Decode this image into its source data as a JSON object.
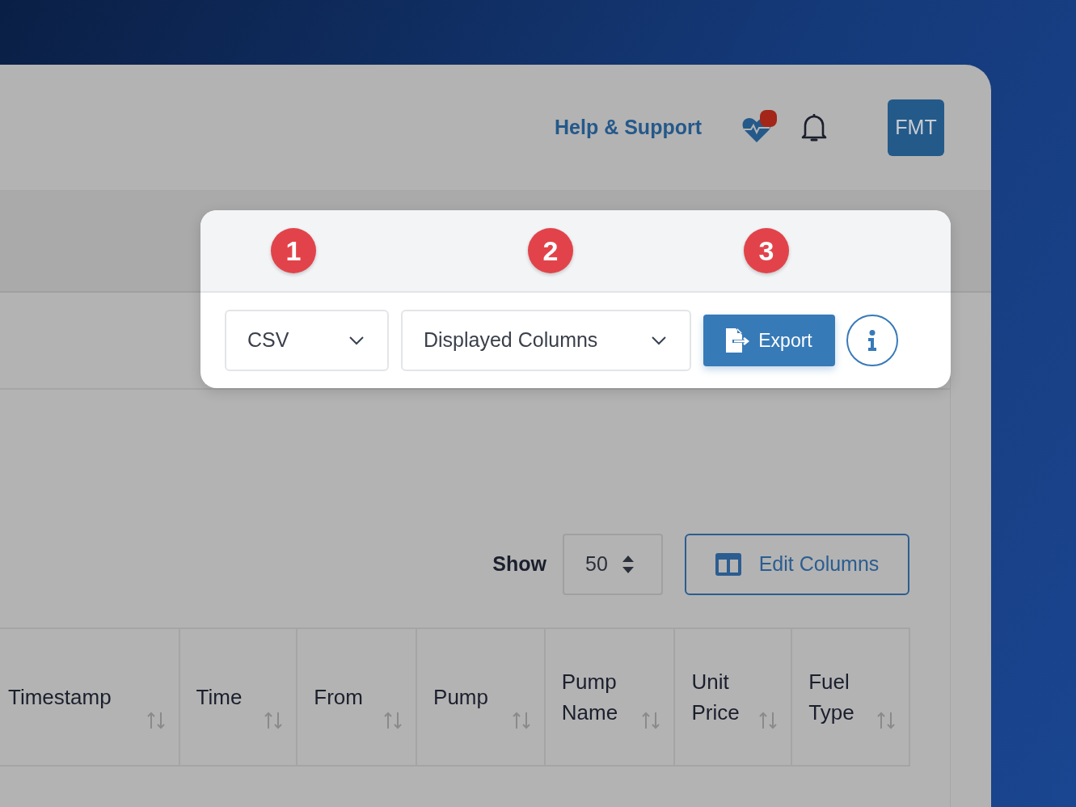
{
  "header": {
    "help_link": "Help & Support",
    "health_alert": true,
    "avatar": "FMT"
  },
  "export_popup": {
    "steps": [
      "1",
      "2",
      "3"
    ],
    "format": "CSV",
    "columns": "Displayed Columns",
    "export_button": "Export"
  },
  "toolbar": {
    "show_label": "Show",
    "page_size": "50",
    "edit_columns": "Edit Columns"
  },
  "table": {
    "columns": [
      {
        "label": "Timestamp"
      },
      {
        "label": "Time"
      },
      {
        "label": "From"
      },
      {
        "label": "Pump"
      },
      {
        "label": "Pump Name"
      },
      {
        "label": "Unit Price"
      },
      {
        "label": "Fuel Type"
      }
    ]
  }
}
